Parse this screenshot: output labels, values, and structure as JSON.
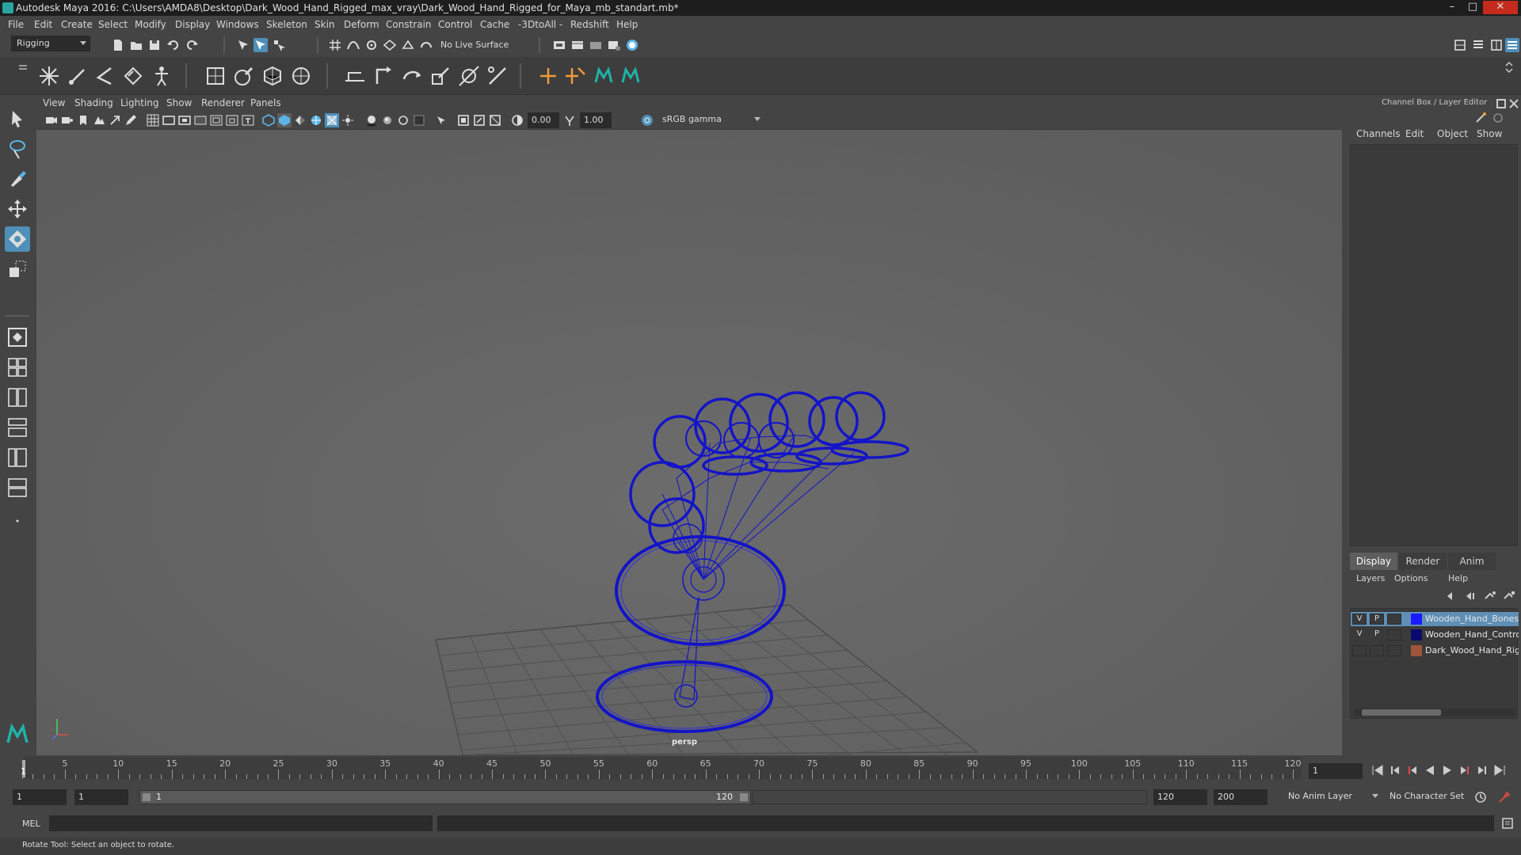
{
  "window": {
    "title": "Autodesk Maya 2016: C:\\Users\\AMDA8\\Desktop\\Dark_Wood_Hand_Rigged_max_vray\\Dark_Wood_Hand_Rigged_for_Maya_mb_standart.mb*"
  },
  "menubar": {
    "items": [
      "File",
      "Edit",
      "Create",
      "Select",
      "Modify",
      "Display",
      "Windows",
      "Skeleton",
      "Skin",
      "Deform",
      "Constrain",
      "Control",
      "Cache",
      "-3DtoAll -",
      "Redshift",
      "Help"
    ]
  },
  "statusline": {
    "menuset": "Rigging",
    "live_surface": "No Live Surface"
  },
  "panel": {
    "menus": [
      "View",
      "Shading",
      "Lighting",
      "Show",
      "Renderer",
      "Panels"
    ],
    "exposure": "0.00",
    "gamma": "1.00",
    "colorspace": "sRGB gamma",
    "camera_label": "persp"
  },
  "rightpanel": {
    "title": "Channel Box / Layer Editor",
    "channel_tabs": [
      "Channels",
      "Edit",
      "Object",
      "Show"
    ],
    "layer_tabs": [
      "Display",
      "Render",
      "Anim"
    ],
    "layer_menus": [
      "Layers",
      "Options",
      "Help"
    ],
    "layers": [
      {
        "v": "V",
        "p": "P",
        "name": "Wooden_Hand_Bones",
        "color": "#1a1aff",
        "selected": true
      },
      {
        "v": "V",
        "p": "P",
        "name": "Wooden_Hand_Controllers",
        "color": "#0a0a6e",
        "selected": false
      },
      {
        "v": "",
        "p": "",
        "name": "Dark_Wood_Hand_Rigged",
        "color": "#a0553a",
        "selected": false
      }
    ]
  },
  "timeslider": {
    "ticks": [
      5,
      10,
      15,
      20,
      25,
      30,
      35,
      40,
      45,
      50,
      55,
      60,
      65,
      70,
      75,
      80,
      85,
      90,
      95,
      100,
      105,
      110,
      115,
      120
    ],
    "current_frame_marker": "1",
    "current_frame": "1"
  },
  "range": {
    "start": "1",
    "playback_start": "1",
    "range_start_label": "1",
    "range_end_label": "120",
    "playback_end": "120",
    "end": "200",
    "anim_layer": "No Anim Layer",
    "character_set": "No Character Set"
  },
  "cmdline": {
    "lang": "MEL"
  },
  "helpline": {
    "text": "Rotate Tool: Select an object to rotate."
  },
  "colors": {
    "wire": "#1414c8",
    "accent": "#4f8fb9",
    "viewport_bg": "#646464"
  }
}
